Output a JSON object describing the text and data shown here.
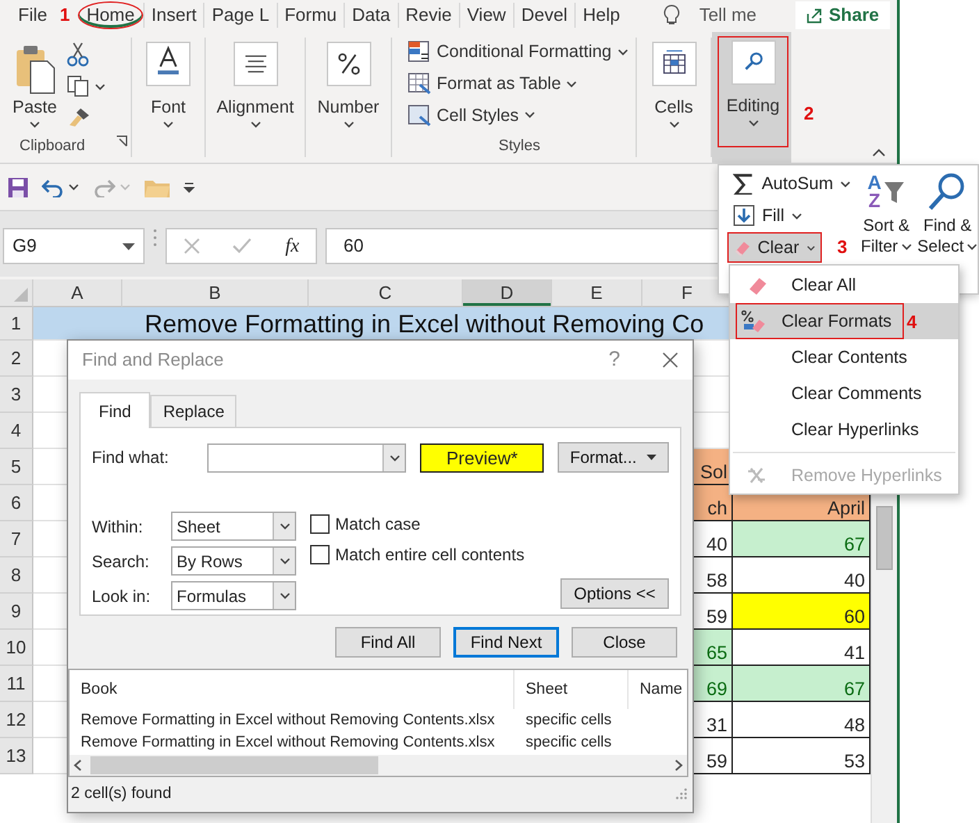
{
  "ribbon_tabs": [
    {
      "label": "File",
      "selected": false
    },
    {
      "label": "Home",
      "selected": true,
      "marked": true,
      "step": "1"
    },
    {
      "label": "Insert",
      "selected": false
    },
    {
      "label": "Page L",
      "selected": false
    },
    {
      "label": "Formu",
      "selected": false
    },
    {
      "label": "Data",
      "selected": false
    },
    {
      "label": "Revie",
      "selected": false
    },
    {
      "label": "View",
      "selected": false
    },
    {
      "label": "Devel",
      "selected": false
    },
    {
      "label": "Help",
      "selected": false
    }
  ],
  "tell_me": "Tell me",
  "share": "Share",
  "ribbon_groups": [
    {
      "kind": "clipboard",
      "button": "Paste",
      "label": "Clipboard"
    },
    {
      "kind": "font",
      "button": "Font"
    },
    {
      "kind": "alignment",
      "button": "Alignment"
    },
    {
      "kind": "number",
      "button": "Number"
    },
    {
      "kind": "styles",
      "items": [
        "Conditional Formatting",
        "Format as Table",
        "Cell Styles"
      ],
      "label": "Styles"
    },
    {
      "kind": "cells",
      "button": "Cells"
    },
    {
      "kind": "editing",
      "button": "Editing",
      "pressed": true,
      "marked": true,
      "step": "2"
    }
  ],
  "formula_bar": {
    "name_box": "G9",
    "fx": "fx",
    "value": "60"
  },
  "sheet": {
    "columns": [
      {
        "label": "A",
        "selected": false
      },
      {
        "label": "B",
        "selected": false
      },
      {
        "label": "C",
        "selected": false
      },
      {
        "label": "D",
        "selected": true
      },
      {
        "label": "E",
        "selected": false
      },
      {
        "label": "F",
        "selected": false
      }
    ],
    "title": "Remove Formatting in Excel without Removing Co",
    "rows": [
      {
        "label": "1"
      },
      {
        "label": "2"
      },
      {
        "label": "3"
      },
      {
        "label": "4"
      },
      {
        "label": "5",
        "cells": [
          {
            "text": "Sol",
            "kind": "header"
          }
        ]
      },
      {
        "label": "6",
        "cells": [
          {
            "text": "ch",
            "kind": "header"
          },
          {
            "text": "April",
            "kind": "header"
          }
        ]
      },
      {
        "label": "7",
        "cells": [
          {
            "text": "40",
            "kind": "plain"
          },
          {
            "text": "67",
            "kind": "good"
          }
        ]
      },
      {
        "label": "8",
        "cells": [
          {
            "text": "58",
            "kind": "plain"
          },
          {
            "text": "40",
            "kind": "plain"
          }
        ]
      },
      {
        "label": "9",
        "cells": [
          {
            "text": "59",
            "kind": "plain"
          },
          {
            "text": "60",
            "kind": "highlight"
          }
        ]
      },
      {
        "label": "10",
        "cells": [
          {
            "text": "65",
            "kind": "good"
          },
          {
            "text": "41",
            "kind": "plain"
          }
        ]
      },
      {
        "label": "11",
        "cells": [
          {
            "text": "69",
            "kind": "good"
          },
          {
            "text": "67",
            "kind": "good"
          }
        ]
      },
      {
        "label": "12",
        "cells": [
          {
            "text": "31",
            "kind": "plain"
          },
          {
            "text": "48",
            "kind": "plain"
          }
        ]
      },
      {
        "label": "13",
        "cells": [
          {
            "text": "59",
            "kind": "plain"
          },
          {
            "text": "53",
            "kind": "plain"
          }
        ]
      }
    ]
  },
  "editing_panel": {
    "items": [
      {
        "label": "AutoSum",
        "kind": "autosum",
        "pressed": false
      },
      {
        "label": "Fill",
        "kind": "fill",
        "pressed": false
      },
      {
        "label": "Clear",
        "kind": "clear",
        "pressed": true,
        "marked": true,
        "step": "3"
      }
    ],
    "big": [
      {
        "line1": "Sort &",
        "line2": "Filter",
        "kind": "sort",
        "icon_letters": [
          "A",
          "Z"
        ]
      },
      {
        "line1": "Find &",
        "line2": "Select",
        "kind": "find"
      }
    ]
  },
  "clear_menu": [
    {
      "label": "Clear All",
      "kind": "eraser",
      "selected": false,
      "disabled": false
    },
    {
      "label": "Clear Formats",
      "kind": "format",
      "selected": true,
      "disabled": false,
      "marked": true,
      "step": "4"
    },
    {
      "label": "Clear Contents",
      "kind": "none",
      "selected": false,
      "disabled": false
    },
    {
      "label": "Clear Comments",
      "kind": "none",
      "selected": false,
      "disabled": false
    },
    {
      "label": "Clear Hyperlinks",
      "kind": "none",
      "selected": false,
      "disabled": false
    },
    {
      "label": "Remove Hyperlinks",
      "kind": "unlink",
      "selected": false,
      "disabled": true,
      "separator_before": true
    }
  ],
  "dialog": {
    "title": "Find and Replace",
    "help": "?",
    "tabs": [
      {
        "label": "Find",
        "selected": true
      },
      {
        "label": "Replace",
        "selected": false
      }
    ],
    "find_label": "Find what:",
    "preview": "Preview*",
    "format_button": "Format...",
    "options": [
      {
        "label": "Within:",
        "value": "Sheet"
      },
      {
        "label": "Search:",
        "value": "By Rows"
      },
      {
        "label": "Look in:",
        "value": "Formulas"
      }
    ],
    "checkboxes": [
      {
        "label": "Match case",
        "checked": false
      },
      {
        "label": "Match entire cell contents",
        "checked": false
      }
    ],
    "options_button": "Options <<",
    "buttons": [
      {
        "label": "Find All",
        "default": false
      },
      {
        "label": "Find Next",
        "default": true
      },
      {
        "label": "Close",
        "default": false
      }
    ],
    "results": {
      "columns": [
        "Book",
        "Sheet",
        "Name"
      ],
      "rows": [
        [
          "Remove Formatting in Excel without Removing Contents.xlsx",
          "specific cells"
        ],
        [
          "Remove Formatting in Excel without Removing Contents.xlsx",
          "specific cells"
        ]
      ]
    },
    "status": "2 cell(s) found"
  }
}
